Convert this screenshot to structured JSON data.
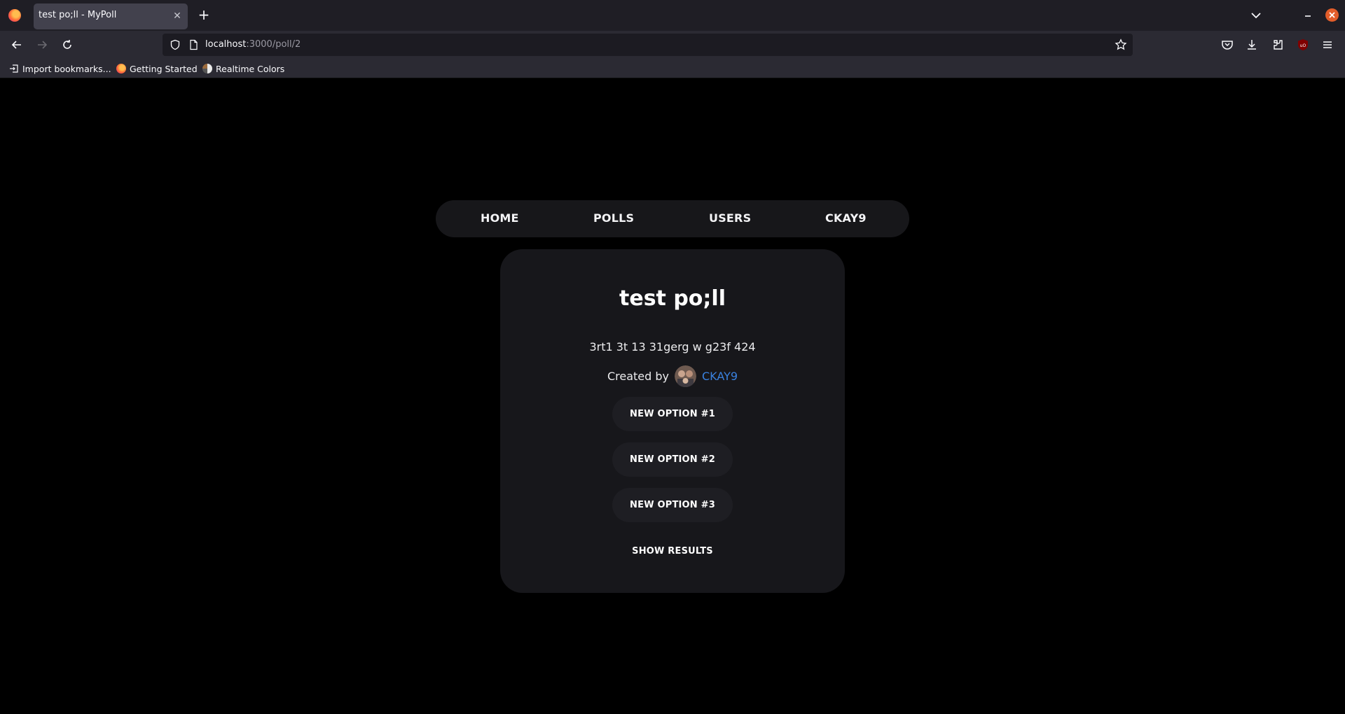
{
  "browser": {
    "tab_title": "test po;ll - MyPoll",
    "url_host": "localhost",
    "url_path": ":3000/poll/2",
    "bookmarks": [
      {
        "label": "Import bookmarks...",
        "icon": "import-icon"
      },
      {
        "label": "Getting Started",
        "icon": "firefox-icon"
      },
      {
        "label": "Realtime Colors",
        "icon": "realtime-colors-icon"
      }
    ]
  },
  "nav": {
    "items": [
      "HOME",
      "POLLS",
      "USERS",
      "CKAY9"
    ]
  },
  "poll": {
    "title": "test po;ll",
    "description": "3rt1 3t 13 31gerg w g23f 424",
    "created_by_label": "Created by",
    "author": "CKAY9",
    "options": [
      "NEW OPTION #1",
      "NEW OPTION #2",
      "NEW OPTION #3"
    ],
    "show_results_label": "SHOW RESULTS"
  },
  "colors": {
    "page_bg": "#000000",
    "card_bg": "#17171b",
    "link": "#3a82e0"
  }
}
